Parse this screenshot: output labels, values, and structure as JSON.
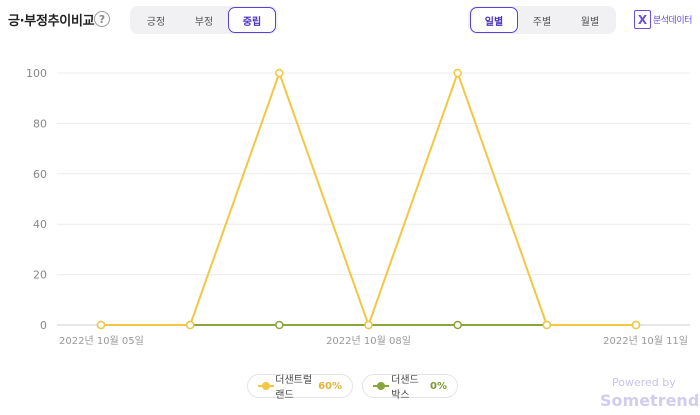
{
  "header": {
    "title": "긍·부정추이비교",
    "help_icon": "?",
    "sentiment_tabs": [
      {
        "label": "긍정",
        "active": false
      },
      {
        "label": "부정",
        "active": false
      },
      {
        "label": "중립",
        "active": true
      }
    ],
    "period_tabs": [
      {
        "label": "일별",
        "active": true
      },
      {
        "label": "주별",
        "active": false
      },
      {
        "label": "월별",
        "active": false
      }
    ],
    "excel_icon": "X",
    "excel_label": "분석데이터"
  },
  "chart_data": {
    "type": "line",
    "title": "",
    "xlabel": "",
    "ylabel": "",
    "ylim": [
      0,
      100
    ],
    "yticks": [
      0,
      20,
      40,
      60,
      80,
      100
    ],
    "x": [
      "2022-10-05",
      "2022-10-06",
      "2022-10-07",
      "2022-10-08",
      "2022-10-09",
      "2022-10-10",
      "2022-10-11"
    ],
    "xtick_labels": [
      {
        "index": 0,
        "label": "2022년 10월 05일"
      },
      {
        "index": 3,
        "label": "2022년 10월 08일"
      },
      {
        "index": 6,
        "label": "2022년 10월 11일"
      }
    ],
    "series": [
      {
        "name": "더샌트럴랜드",
        "percent": "60%",
        "color": "#f2c744",
        "values": [
          0,
          0,
          100,
          0,
          100,
          0,
          0
        ]
      },
      {
        "name": "더샌드박스",
        "percent": "0%",
        "color": "#8aa63a",
        "values": [
          0,
          0,
          0,
          0,
          0,
          0,
          0
        ]
      }
    ],
    "grid": true
  },
  "footer": {
    "powered_by": "Powered by",
    "brand": "Sometrend"
  }
}
